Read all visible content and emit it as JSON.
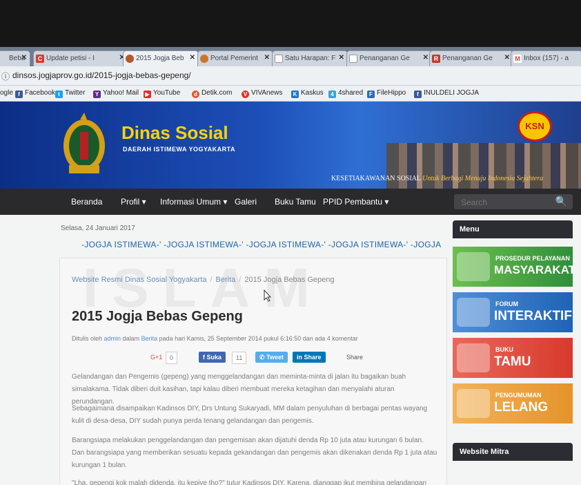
{
  "tabs": [
    {
      "label": "Beba",
      "favicon_color": "#e06d18"
    },
    {
      "label": "Update petisi - I",
      "favicon_color": "#d93b2b",
      "favicon_text": "C"
    },
    {
      "label": "2015 Jogja Beb",
      "favicon_color": "#b35a2a"
    },
    {
      "label": "Portal Pemerint",
      "favicon_color": "#c8772a"
    },
    {
      "label": "Satu Harapan: F",
      "favicon_color": "#9aa5b1"
    },
    {
      "label": "Penanganan Ge",
      "favicon_color": "#9aa5b1"
    },
    {
      "label": "Penanganan Ge",
      "favicon_color": "#c0392b",
      "favicon_text": "R"
    },
    {
      "label": "Inbox (157) - a",
      "favicon_color": "#d14836",
      "favicon_text": "M"
    }
  ],
  "address": {
    "url": "dinsos.jogjaprov.go.id/2015-jogja-bebas-gepeng/"
  },
  "bookmarks": [
    {
      "label": "ogle",
      "color": ""
    },
    {
      "label": "Facebook",
      "color": "#3b5998",
      "icon": "f"
    },
    {
      "label": "Twitter",
      "color": "#1da1f2",
      "icon": "t"
    },
    {
      "label": "Yahoo! Mail",
      "color": "#5f2d91",
      "icon": "Y"
    },
    {
      "label": "YouTube",
      "color": "#e52d27",
      "icon": "▶"
    },
    {
      "label": "Detik.com",
      "color": "#e4572e",
      "icon": "d"
    },
    {
      "label": "VIVAnews",
      "color": "#d9362b",
      "icon": "V"
    },
    {
      "label": "Kaskus",
      "color": "#1b76c5",
      "icon": "K"
    },
    {
      "label": "4shared",
      "color": "#3aa3d9",
      "icon": "4"
    },
    {
      "label": "FileHippo",
      "color": "#2a6db3",
      "icon": "F"
    },
    {
      "label": "INULDELI JOGJA",
      "color": "#3b5998",
      "icon": "f"
    }
  ],
  "header": {
    "title": "Dinas Sosial",
    "subtitle": "DAERAH ISTIMEWA YOGYAKARTA",
    "badge": "KSN",
    "slogan_main": "KESETIAKAWANAN SOSIAL",
    "slogan_sub": "Untuk Berbagi Menuju Indonesia Sejahtera"
  },
  "nav": {
    "items": [
      "Beranda",
      "Profil ▾",
      "Informasi Umum ▾",
      "Galeri",
      "Buku Tamu",
      "PPID Pembantu ▾"
    ],
    "search_placeholder": "Search"
  },
  "main": {
    "date": "Selasa, 24 Januari 2017",
    "ticker": "-JOGJA ISTIMEWA-'   -JOGJA ISTIMEWA-'   -JOGJA ISTIMEWA-'   -JOGJA ISTIMEWA-'   -JOGJA",
    "breadcrumb": [
      "Website Resmi Dinas Sosial Yogyakarta",
      "Berita",
      "2015 Jogja Bebas Gepeng"
    ],
    "title": "2015 Jogja Bebas Gepeng",
    "meta": {
      "prefix": "Ditulis oleh ",
      "author": "admin",
      "in": " dalam ",
      "category": "Berita",
      "rest": " pada hari Kamis, 25 September 2014 pukul 6:16:50 dan ada 4 komentar"
    },
    "share": {
      "gplus": "G+1",
      "gplus_count": "0",
      "fb": "Suka",
      "fb_count": "11",
      "tweet": "Tweet",
      "linkedin": "Share",
      "share": "Share"
    },
    "paragraphs": [
      "Gelandangan dan Pengemis (gepeng) yang menggelandangan dan meminta-minta di jalan itu bagaikan buah simalakama. Tidak diberi duit kasihan, tapi kalau diberi membuat mereka ketagihan dan menyalahi aturan perundangan.",
      "Sebagaimana disampaikan Kadinsos DIY, Drs Untung Sukaryadi, MM dalam penyuluhan di berbagai pentas wayang kulit di desa-desa, DIY sudah punya perda tenang gelandangan dan pengemis.",
      "Barangsiapa melakukan penggelandangan dan pengemisan akan dijatuhi denda Rp 10 juta atau kurungan 6 bulan. Dan barangsiapa yang memberikan sesuatu kepada gekandangan dan pengemis akan dikenakan denda Rp 1 juta atau kurungan 1 bulan.",
      "\"Lha, gepengi kok malah didenda, itu kepiye tho?\" tutur Kadinsos DIY. Karena, dianggap ikut membina gelandangan itu."
    ],
    "watermark": "ISLAM"
  },
  "sidebar": {
    "menu_title": "Menu",
    "banners": [
      {
        "small": "PROSEDUR PELAYANAN",
        "big": "MASYARAKAT",
        "color": "#2f8f3a"
      },
      {
        "small": "FORUM",
        "big": "INTERAKTIF",
        "color": "#1f63b5"
      },
      {
        "small": "BUKU",
        "big": "TAMU",
        "color": "#d83a2c"
      },
      {
        "small": "PENGUMUMAN",
        "big": "LELANG",
        "color": "#e5932a"
      }
    ],
    "mitra_title": "Website Mitra"
  }
}
